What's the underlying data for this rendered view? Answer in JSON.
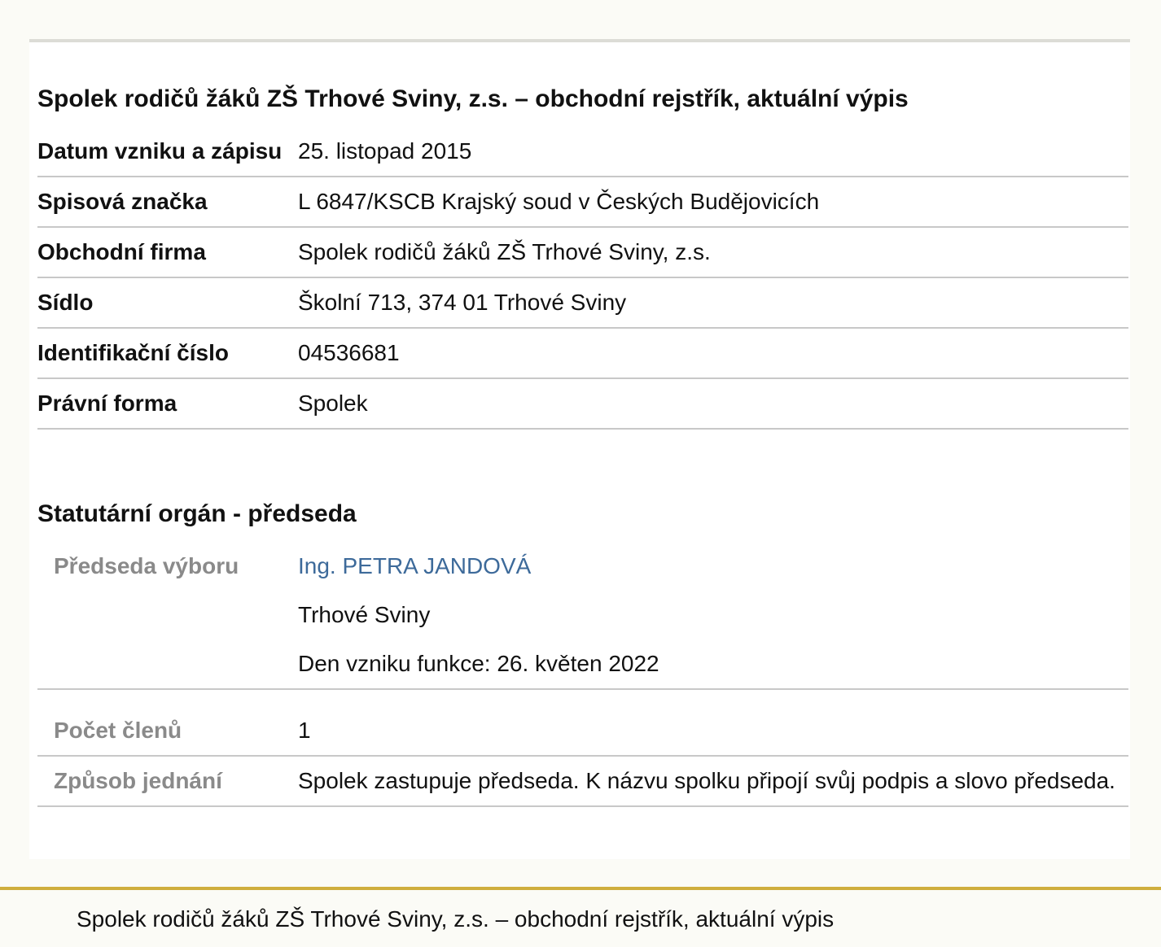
{
  "title": "Spolek rodičů žáků ZŠ Trhové Sviny, z.s. – obchodní rejstřík, aktuální výpis",
  "rows": [
    {
      "label": "Datum vzniku a zápisu",
      "value": "25. listopad 2015"
    },
    {
      "label": "Spisová značka",
      "value": "L 6847/KSCB Krajský soud v Českých Budějovicích"
    },
    {
      "label": "Obchodní firma",
      "value": "Spolek rodičů žáků ZŠ Trhové Sviny, z.s."
    },
    {
      "label": "Sídlo",
      "value": "Školní 713, 374 01 Trhové Sviny"
    },
    {
      "label": "Identifikační číslo",
      "value": "04536681"
    },
    {
      "label": "Právní forma",
      "value": "Spolek"
    }
  ],
  "statutory": {
    "heading": "Statutární orgán - předseda",
    "chair_label": "Předseda výboru",
    "chair_name": "Ing. PETRA JANDOVÁ",
    "chair_city": "Trhové Sviny",
    "chair_since": "Den vzniku funkce: 26. květen 2022",
    "members_label": "Počet členů",
    "members_value": "1",
    "conduct_label": "Způsob jednání",
    "conduct_value": "Spolek zastupuje předseda. K názvu spolku připojí svůj podpis a slovo předseda."
  },
  "footer": {
    "text": "Spolek rodičů žáků ZŠ Trhové Sviny, z.s. – obchodní rejstřík, aktuální výpis"
  },
  "colors": {
    "link": "#3d6a9a",
    "footer_border": "#cfae3d"
  }
}
